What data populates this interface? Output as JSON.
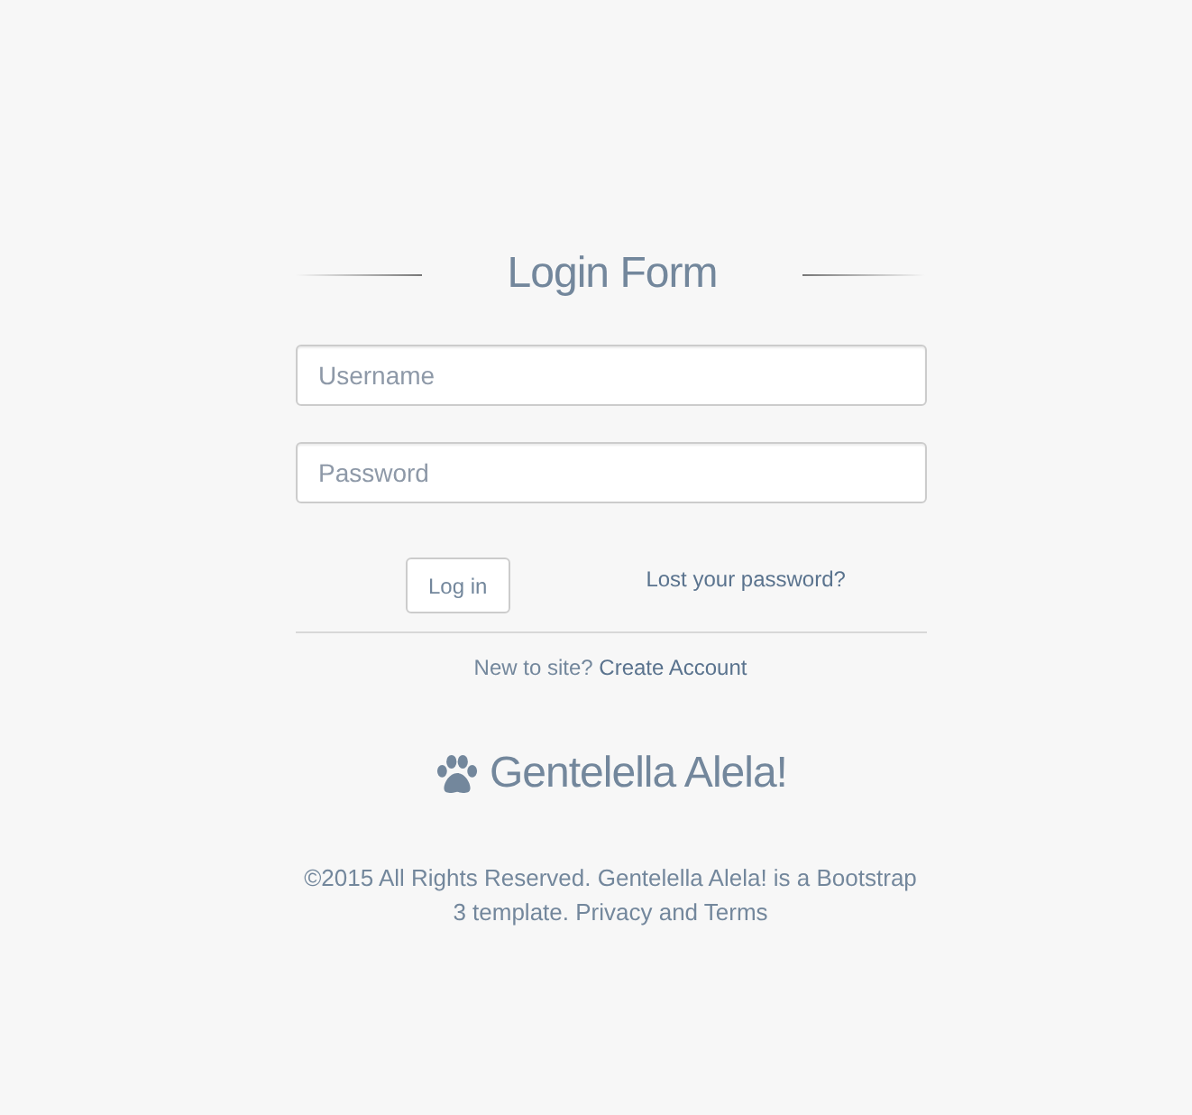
{
  "title": "Login Form",
  "fields": [
    {
      "placeholder": "Username"
    },
    {
      "placeholder": "Password"
    }
  ],
  "login_button": "Log in",
  "lost_password_link": "Lost your password?",
  "signup": {
    "text": "New to site?",
    "link": "Create Account"
  },
  "brand": "Gentelella Alela!",
  "footer": "©2015 All Rights Reserved. Gentelella Alela! is a Bootstrap 3 template. Privacy and Terms"
}
